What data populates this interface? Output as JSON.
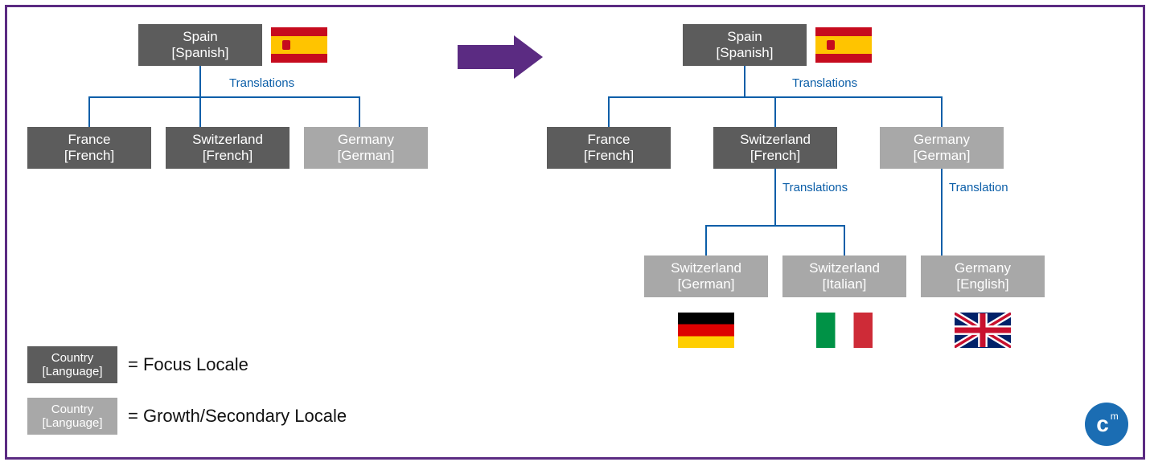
{
  "colors": {
    "border": "#5b2b82",
    "connector": "#0b5ea8",
    "dark_node": "#5c5c5c",
    "light_node": "#a8a8a8"
  },
  "labels": {
    "translations": "Translations",
    "translation": "Translation"
  },
  "left_tree": {
    "root": {
      "country": "Spain",
      "language": "[Spanish]",
      "tone": "dark",
      "flag": "es"
    },
    "root_label": "Translations",
    "children": [
      {
        "country": "France",
        "language": "[French]",
        "tone": "dark"
      },
      {
        "country": "Switzerland",
        "language": "[French]",
        "tone": "dark"
      },
      {
        "country": "Germany",
        "language": "[German]",
        "tone": "light"
      }
    ]
  },
  "right_tree": {
    "root": {
      "country": "Spain",
      "language": "[Spanish]",
      "tone": "dark",
      "flag": "es"
    },
    "root_label": "Translations",
    "children": [
      {
        "country": "France",
        "language": "[French]",
        "tone": "dark"
      },
      {
        "country": "Switzerland",
        "language": "[French]",
        "tone": "dark",
        "child_label": "Translations",
        "children": [
          {
            "country": "Switzerland",
            "language": "[German]",
            "tone": "light",
            "flag": "de"
          },
          {
            "country": "Switzerland",
            "language": "[Italian]",
            "tone": "light",
            "flag": "it"
          }
        ]
      },
      {
        "country": "Germany",
        "language": "[German]",
        "tone": "light",
        "child_label": "Translation",
        "children": [
          {
            "country": "Germany",
            "language": "[English]",
            "tone": "light",
            "flag": "uk"
          }
        ]
      }
    ]
  },
  "legend": {
    "focus": {
      "country": "Country",
      "language": "[Language]",
      "text": "= Focus Locale"
    },
    "growth": {
      "country": "Country",
      "language": "[Language]",
      "text": "= Growth/Secondary Locale"
    }
  },
  "logo": {
    "text": "c",
    "sup": "m"
  }
}
